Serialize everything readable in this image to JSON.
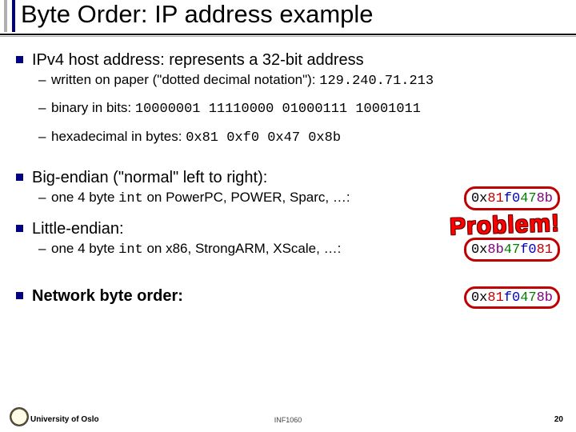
{
  "title": "Byte Order: IP address example",
  "ipv4": {
    "heading": "IPv4 host address: represents a 32-bit address",
    "dotted_label": "written on paper (\"dotted decimal notation\"): ",
    "dotted_value": "129.240.71.213",
    "binary_label": "binary in bits: ",
    "binary_value": "10000001 11110000 01000111 10001011",
    "hex_label": "hexadecimal in bytes: ",
    "hex_value": "0x81 0xf0 0x47 0x8b"
  },
  "big": {
    "heading": "Big-endian (\"normal\" left to right):",
    "sub_pre": "one 4 byte ",
    "sub_int": "int",
    "sub_post": " on PowerPC, POWER, Sparc, …: ",
    "hex_prefix": "0x",
    "h1": "81",
    "h2": "f0",
    "h3": "47",
    "h4": "8b"
  },
  "lit": {
    "heading": "Little-endian:",
    "sub_pre": "one 4 byte ",
    "sub_int": "int",
    "sub_post": " on x86, StrongARM, XScale, …: ",
    "hex_prefix": "0x",
    "h1": "8b",
    "h2": "47",
    "h3": "f0",
    "h4": "81"
  },
  "net": {
    "heading": "Network byte order:",
    "hex_prefix": "0x",
    "h1": "81",
    "h2": "f0",
    "h3": "47",
    "h4": "8b"
  },
  "problem": "Problem!",
  "footer": {
    "university": "University of Oslo",
    "course": "INF1060",
    "page": "20"
  }
}
